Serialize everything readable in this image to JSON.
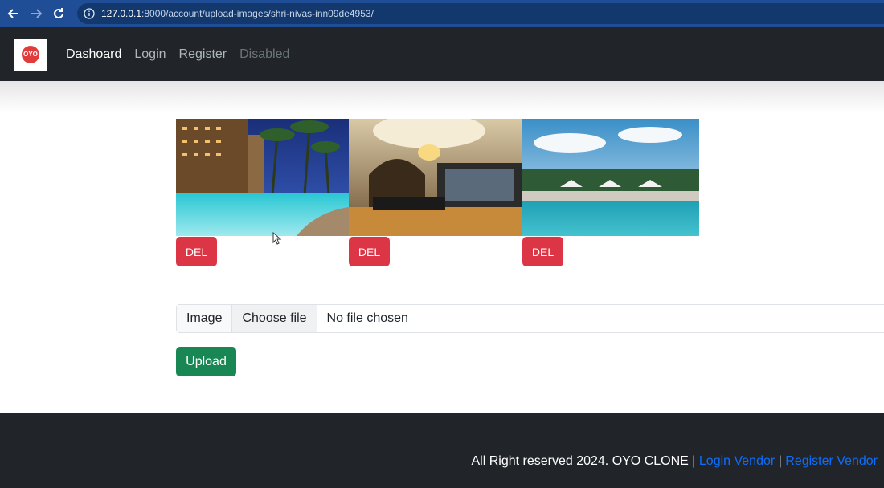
{
  "browser": {
    "url_host": "127.0.0.1",
    "url_path": ":8000/account/upload-images/shri-nivas-inn09de4953/"
  },
  "navbar": {
    "logo_text": "OYO",
    "links": [
      {
        "label": "Dashoard",
        "color": "#ffffff"
      },
      {
        "label": "Login",
        "color": "#adb5bd"
      },
      {
        "label": "Register",
        "color": "#adb5bd"
      },
      {
        "label": "Disabled",
        "color": "#6c757d"
      }
    ]
  },
  "gallery": {
    "images": [
      {
        "icon": "hotel-pool-night-image",
        "delete_label": "DEL"
      },
      {
        "icon": "hotel-lobby-image",
        "delete_label": "DEL"
      },
      {
        "icon": "resort-pool-image",
        "delete_label": "DEL"
      }
    ]
  },
  "upload_form": {
    "input_label": "Image",
    "choose_file_label": "Choose file",
    "file_status": "No file chosen",
    "upload_label": "Upload"
  },
  "footer": {
    "text": "All Right reserved 2024. OYO CLONE",
    "separator": "|",
    "link1": "Login Vendor",
    "link2": "Register Vendor"
  },
  "colors": {
    "navbar_bg": "#212529",
    "danger": "#dc3545",
    "success": "#198754",
    "link": "#0d6efd"
  }
}
